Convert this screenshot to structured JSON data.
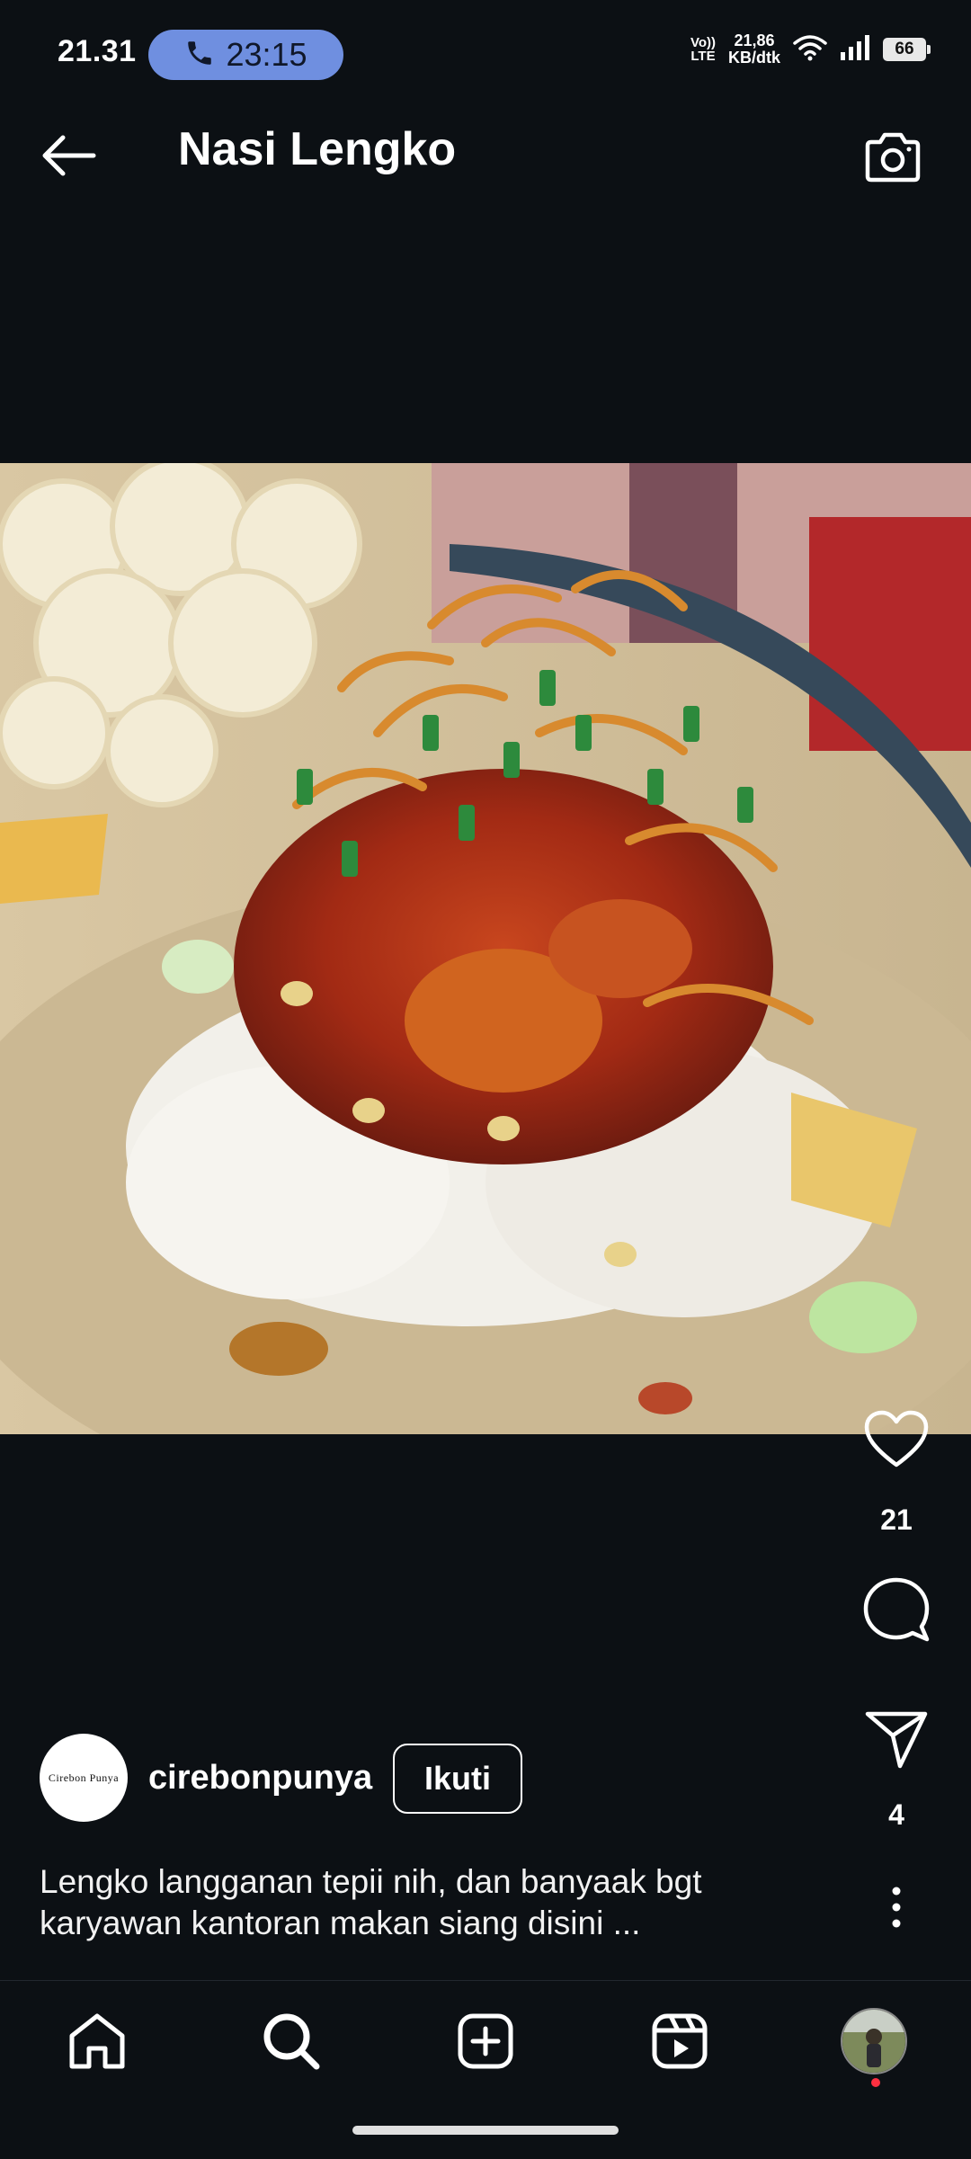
{
  "status_bar": {
    "time": "21.31",
    "call_timer": "23:15",
    "volte_top": "Vo))",
    "volte_bottom": "LTE",
    "speed_value": "21,86",
    "speed_unit": "KB/dtk",
    "battery": "66",
    "icons": [
      "phone-icon",
      "wifi-icon",
      "signal-icon",
      "battery-icon"
    ]
  },
  "header": {
    "title": "Nasi Lengko",
    "back_icon": "arrow-left-icon",
    "camera_icon": "camera-icon"
  },
  "post": {
    "image": "food-photo",
    "likes": "21",
    "shares": "4",
    "author": {
      "avatar_text": "Cirebon Punya",
      "username": "cirebonpunya",
      "follow_label": "Ikuti"
    },
    "caption": "Lengko langganan tepii nih, dan banyaak bgt karyawan kantoran makan siang disini ..."
  },
  "bottom_nav": {
    "items": [
      "home-icon",
      "search-icon",
      "add-post-icon",
      "reels-icon",
      "profile-avatar"
    ]
  },
  "colors": {
    "background": "#0c1014",
    "call_pill": "#6f8fe0",
    "notification_dot": "#ff3040"
  }
}
